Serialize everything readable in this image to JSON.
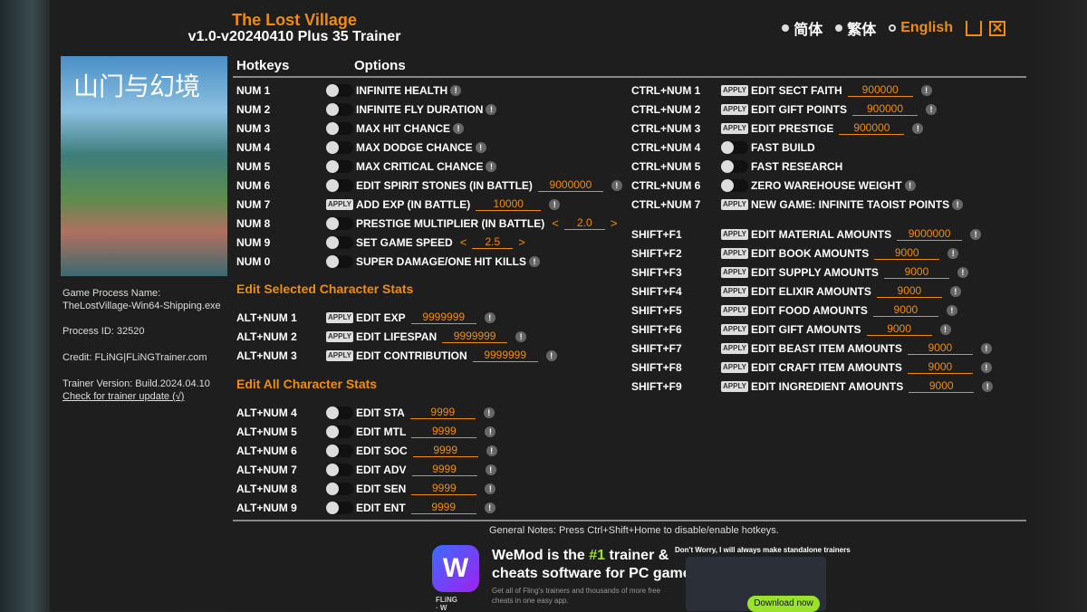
{
  "app": {
    "title": "The Lost Village",
    "subtitle": "v1.0-v20240410 Plus 35 Trainer"
  },
  "languages": [
    {
      "label": "简体",
      "selected": false
    },
    {
      "label": "繁体",
      "selected": false
    },
    {
      "label": "English",
      "selected": true
    }
  ],
  "window_buttons": {
    "minimize": "minimize-icon",
    "close": "close-icon"
  },
  "cover_text": "山门与幻境",
  "info": {
    "process_name_label": "Game Process Name:",
    "process_name": "TheLostVillage-Win64-Shipping.exe",
    "process_id": "Process ID: 32520",
    "credit": "Credit: FLiNG|FLiNGTrainer.com",
    "version": "Trainer Version: Build.2024.04.10",
    "update_link": "Check for trainer update (√)"
  },
  "headers": {
    "hotkeys": "Hotkeys",
    "options": "Options"
  },
  "colors": {
    "accent": "#f08c10",
    "bg": "#1e1e1e"
  },
  "sections": {
    "selected": "Edit Selected Character Stats",
    "all": "Edit All Character Stats"
  },
  "left_main": [
    {
      "key": "NUM 1",
      "type": "toggle",
      "label": "INFINITE HEALTH",
      "info": true
    },
    {
      "key": "NUM 2",
      "type": "toggle",
      "label": "INFINITE FLY DURATION",
      "info": true
    },
    {
      "key": "NUM 3",
      "type": "toggle",
      "label": "MAX HIT CHANCE",
      "info": true
    },
    {
      "key": "NUM 4",
      "type": "toggle",
      "label": "MAX DODGE CHANCE",
      "info": true
    },
    {
      "key": "NUM 5",
      "type": "toggle",
      "label": "MAX CRITICAL CHANCE",
      "info": true
    },
    {
      "key": "NUM 6",
      "type": "toggle",
      "label": "EDIT SPIRIT STONES (IN BATTLE)",
      "value": "9000000",
      "info": true
    },
    {
      "key": "NUM 7",
      "type": "apply",
      "label": "ADD EXP (IN BATTLE)",
      "value": "10000",
      "info": true
    },
    {
      "key": "NUM 8",
      "type": "toggle",
      "label": "PRESTIGE MULTIPLIER (IN BATTLE)",
      "stepper": "2.0"
    },
    {
      "key": "NUM 9",
      "type": "toggle",
      "label": "SET GAME SPEED",
      "stepper": "2.5"
    },
    {
      "key": "NUM 0",
      "type": "toggle",
      "label": "SUPER DAMAGE/ONE HIT KILLS",
      "info": true
    }
  ],
  "left_selected": [
    {
      "key": "ALT+NUM 1",
      "type": "apply",
      "label": "EDIT EXP",
      "value": "9999999",
      "info": true
    },
    {
      "key": "ALT+NUM 2",
      "type": "apply",
      "label": "EDIT LIFESPAN",
      "value": "9999999",
      "info": true
    },
    {
      "key": "ALT+NUM 3",
      "type": "apply",
      "label": "EDIT CONTRIBUTION",
      "value": "9999999",
      "info": true
    }
  ],
  "left_all": [
    {
      "key": "ALT+NUM 4",
      "type": "toggle",
      "label": "EDIT STA",
      "value": "9999",
      "info": true
    },
    {
      "key": "ALT+NUM 5",
      "type": "toggle",
      "label": "EDIT MTL",
      "value": "9999",
      "info": true
    },
    {
      "key": "ALT+NUM 6",
      "type": "toggle",
      "label": "EDIT SOC",
      "value": "9999",
      "info": true
    },
    {
      "key": "ALT+NUM 7",
      "type": "toggle",
      "label": "EDIT ADV",
      "value": "9999",
      "info": true
    },
    {
      "key": "ALT+NUM 8",
      "type": "toggle",
      "label": "EDIT SEN",
      "value": "9999",
      "info": true
    },
    {
      "key": "ALT+NUM 9",
      "type": "toggle",
      "label": "EDIT ENT",
      "value": "9999",
      "info": true
    }
  ],
  "right_ctrl": [
    {
      "key": "CTRL+NUM 1",
      "type": "apply",
      "label": "EDIT SECT FAITH",
      "value": "900000",
      "info": true
    },
    {
      "key": "CTRL+NUM 2",
      "type": "apply",
      "label": "EDIT GIFT POINTS",
      "value": "900000",
      "info": true
    },
    {
      "key": "CTRL+NUM 3",
      "type": "apply",
      "label": "EDIT PRESTIGE",
      "value": "900000",
      "info": true
    },
    {
      "key": "CTRL+NUM 4",
      "type": "toggle",
      "label": "FAST BUILD"
    },
    {
      "key": "CTRL+NUM 5",
      "type": "toggle",
      "label": "FAST RESEARCH"
    },
    {
      "key": "CTRL+NUM 6",
      "type": "toggle",
      "label": "ZERO WAREHOUSE WEIGHT",
      "info": true
    },
    {
      "key": "CTRL+NUM 7",
      "type": "apply",
      "label": "NEW GAME: INFINITE TAOIST POINTS",
      "info": true
    }
  ],
  "right_shift": [
    {
      "key": "SHIFT+F1",
      "type": "apply",
      "label": "EDIT MATERIAL AMOUNTS",
      "value": "9000000",
      "info": true
    },
    {
      "key": "SHIFT+F2",
      "type": "apply",
      "label": "EDIT BOOK AMOUNTS",
      "value": "9000",
      "info": true
    },
    {
      "key": "SHIFT+F3",
      "type": "apply",
      "label": "EDIT SUPPLY AMOUNTS",
      "value": "9000",
      "info": true
    },
    {
      "key": "SHIFT+F4",
      "type": "apply",
      "label": "EDIT ELIXIR AMOUNTS",
      "value": "9000",
      "info": true
    },
    {
      "key": "SHIFT+F5",
      "type": "apply",
      "label": "EDIT FOOD AMOUNTS",
      "value": "9000",
      "info": true
    },
    {
      "key": "SHIFT+F6",
      "type": "apply",
      "label": "EDIT GIFT AMOUNTS",
      "value": "9000",
      "info": true
    },
    {
      "key": "SHIFT+F7",
      "type": "apply",
      "label": "EDIT BEAST ITEM AMOUNTS",
      "value": "9000",
      "info": true
    },
    {
      "key": "SHIFT+F8",
      "type": "apply",
      "label": "EDIT CRAFT ITEM AMOUNTS",
      "value": "9000",
      "info": true
    },
    {
      "key": "SHIFT+F9",
      "type": "apply",
      "label": "EDIT INGREDIENT AMOUNTS",
      "value": "9000",
      "info": true
    }
  ],
  "apply_label": "APPLY",
  "note": "General Notes: Press Ctrl+Shift+Home to disable/enable hotkeys.",
  "ad": {
    "line1a": "WeMod is the ",
    "line1b": "#1",
    "line1c": " trainer &",
    "line2": "cheats software for PC games",
    "sub": "Get all of Fling's trainers and thousands of more free cheats in one easy app.",
    "brand": "FLiNG · W",
    "tagline": "Don't Worry, I will always make standalone trainers",
    "download": "Download now"
  }
}
